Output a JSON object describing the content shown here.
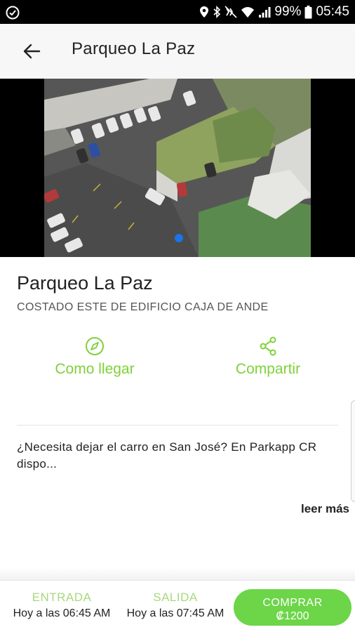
{
  "status_bar": {
    "battery_percent": "99%",
    "time": "05:45",
    "icons": [
      "check-circle-icon",
      "location-icon",
      "bluetooth-icon",
      "mute-icon",
      "wifi-icon",
      "signal-icon",
      "battery-icon"
    ]
  },
  "app_bar": {
    "title": "Parqueo La Paz",
    "back_icon": "arrow-back-icon"
  },
  "gallery": {
    "image": "aerial-parking-lot-photo",
    "page_count": 1,
    "current_page": 1,
    "indicator_color": "#1a73e8"
  },
  "place": {
    "name": "Parqueo La Paz",
    "address": "COSTADO ESTE DE EDIFICIO CAJA DE ANDE"
  },
  "actions": {
    "directions_label": "Como llegar",
    "directions_icon": "compass-icon",
    "share_label": "Compartir",
    "share_icon": "share-icon",
    "accent_color": "#7fd13b"
  },
  "description": {
    "line1": "¿Necesita dejar el carro en San José? En Parkapp CR",
    "line2": "dispo...",
    "read_more": "leer más"
  },
  "booking": {
    "entry_caption": "ENTRADA",
    "entry_value": "Hoy a las 06:45 AM",
    "exit_caption": "SALIDA",
    "exit_value": "Hoy a las 07:45 AM",
    "buy_label": "COMPRAR",
    "price": "₡1200",
    "button_color": "#6cd548"
  }
}
